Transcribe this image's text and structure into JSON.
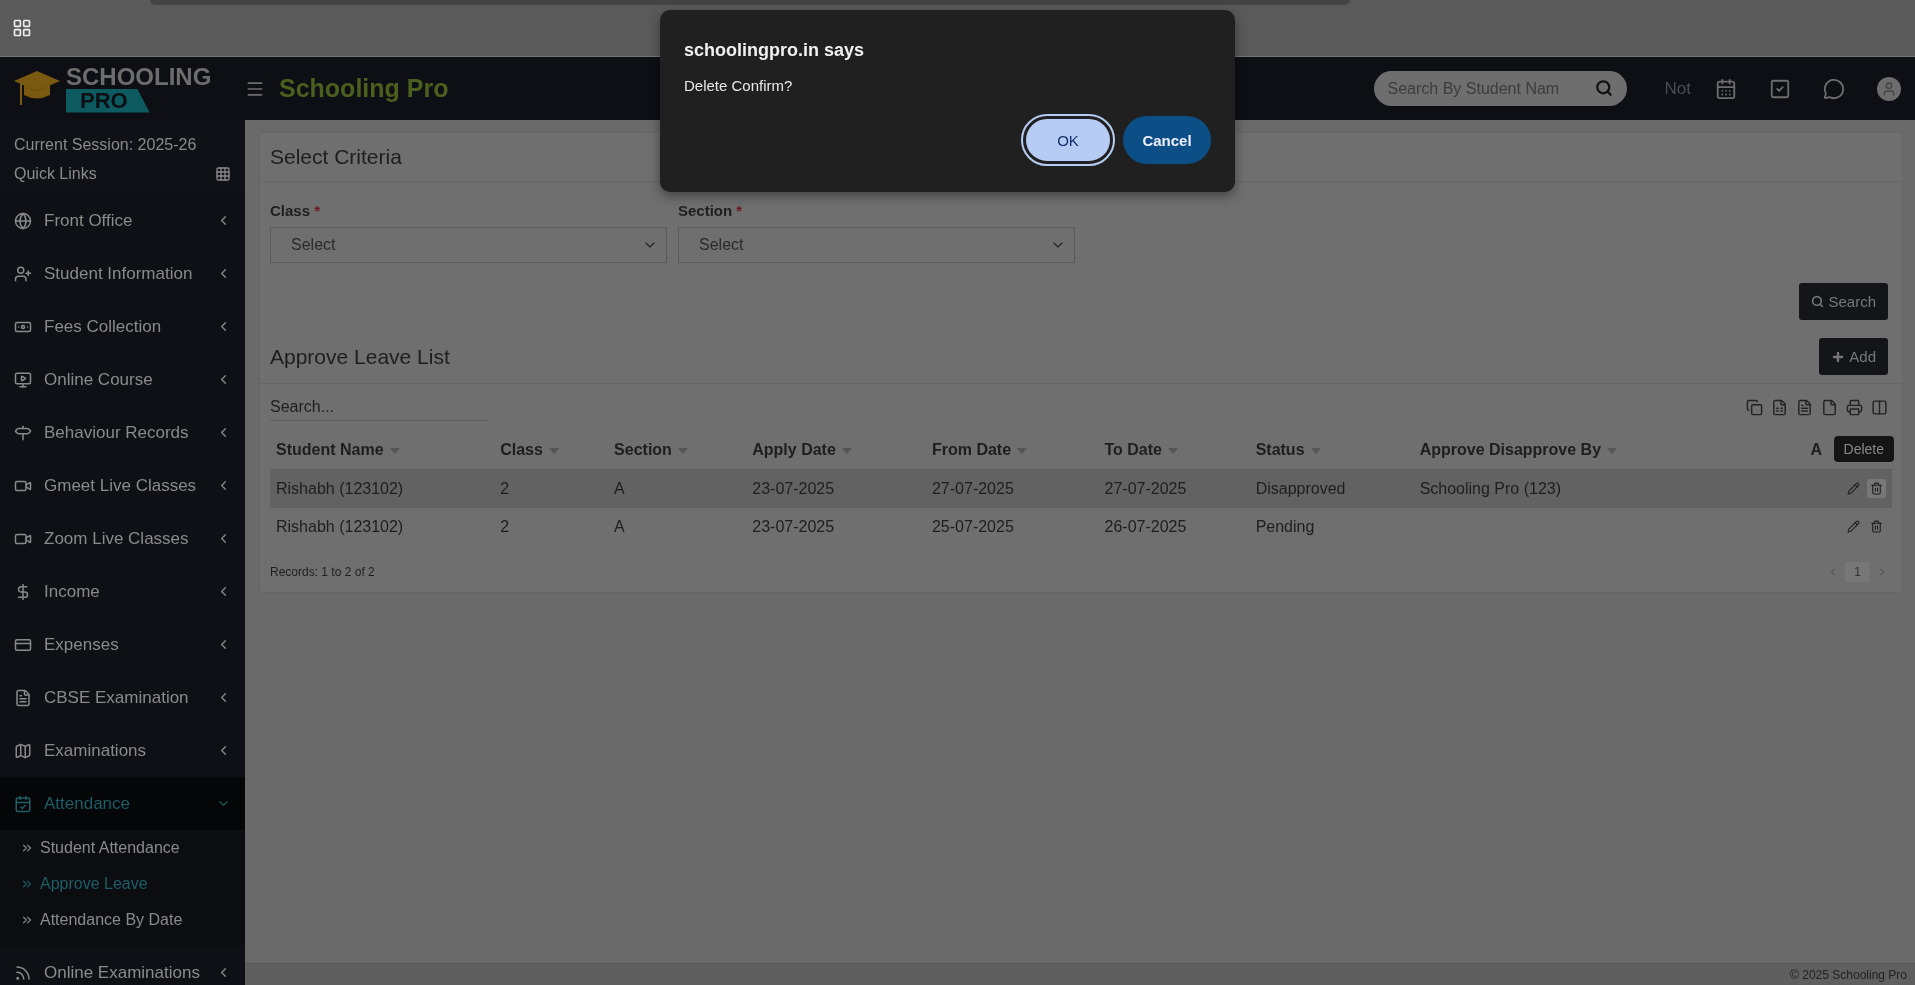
{
  "logo": {
    "line1": "SCHOOLING",
    "line2": "PRO"
  },
  "header": {
    "title": "Schooling Pro",
    "search_placeholder": "Search By Student Nam",
    "notice_text": "Not"
  },
  "sidebar": {
    "session": "Current Session: 2025-26",
    "quick_links": "Quick Links",
    "items": [
      {
        "label": "Front Office",
        "expanded": false,
        "selected": false
      },
      {
        "label": "Student Information",
        "expanded": false,
        "selected": false
      },
      {
        "label": "Fees Collection",
        "expanded": false,
        "selected": false
      },
      {
        "label": "Online Course",
        "expanded": false,
        "selected": false
      },
      {
        "label": "Behaviour Records",
        "expanded": false,
        "selected": false
      },
      {
        "label": "Gmeet Live Classes",
        "expanded": false,
        "selected": false
      },
      {
        "label": "Zoom Live Classes",
        "expanded": false,
        "selected": false
      },
      {
        "label": "Income",
        "expanded": false,
        "selected": false
      },
      {
        "label": "Expenses",
        "expanded": false,
        "selected": false
      },
      {
        "label": "CBSE Examination",
        "expanded": false,
        "selected": false
      },
      {
        "label": "Examinations",
        "expanded": false,
        "selected": false
      },
      {
        "label": "Attendance",
        "expanded": true,
        "selected": true,
        "children": [
          {
            "label": "Student Attendance",
            "selected": false
          },
          {
            "label": "Approve Leave",
            "selected": true
          },
          {
            "label": "Attendance By Date",
            "selected": false
          }
        ]
      },
      {
        "label": "Online Examinations",
        "expanded": false,
        "selected": false
      }
    ]
  },
  "criteria": {
    "title": "Select Criteria",
    "fields": [
      {
        "label": "Class",
        "required_mark": "*",
        "value": "Select"
      },
      {
        "label": "Section",
        "required_mark": "*",
        "value": "Select"
      }
    ],
    "search_button": "Search"
  },
  "list": {
    "title": "Approve Leave List",
    "add_button": "Add",
    "search_placeholder": "Search...",
    "columns": [
      "Student Name",
      "Class",
      "Section",
      "Apply Date",
      "From Date",
      "To Date",
      "Status",
      "Approve Disapprove By",
      "A"
    ],
    "rows": [
      {
        "cells": [
          "Rishabh (123102)",
          "2",
          "A",
          "23-07-2025",
          "27-07-2025",
          "27-07-2025",
          "Disapproved",
          "Schooling Pro (123)"
        ],
        "hovered": true
      },
      {
        "cells": [
          "Rishabh (123102)",
          "2",
          "A",
          "23-07-2025",
          "25-07-2025",
          "26-07-2025",
          "Pending",
          ""
        ],
        "hovered": false
      }
    ],
    "tooltip": "Delete",
    "records": "Records: 1 to 2 of 2",
    "page": "1"
  },
  "footer": "© 2025 Schooling Pro",
  "dialog": {
    "title": "schoolingpro.in says",
    "message": "Delete Confirm?",
    "ok": "OK",
    "cancel": "Cancel"
  }
}
